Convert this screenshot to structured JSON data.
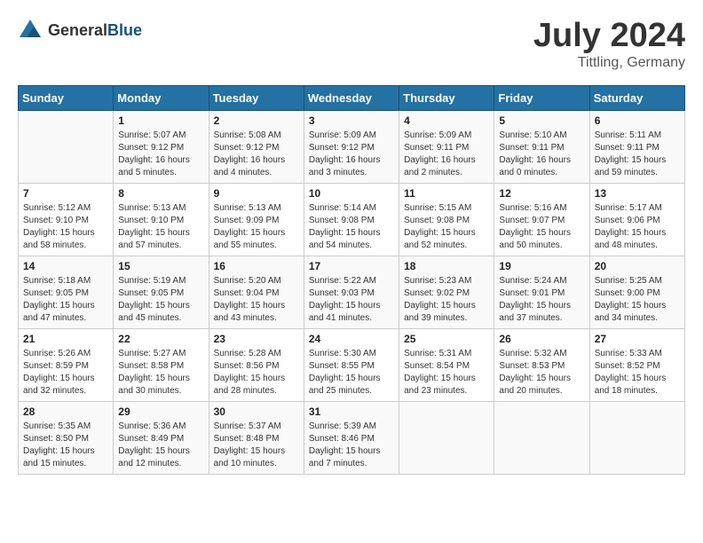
{
  "header": {
    "logo_general": "General",
    "logo_blue": "Blue",
    "month_year": "July 2024",
    "location": "Tittling, Germany"
  },
  "days_of_week": [
    "Sunday",
    "Monday",
    "Tuesday",
    "Wednesday",
    "Thursday",
    "Friday",
    "Saturday"
  ],
  "weeks": [
    [
      {
        "day": "",
        "info": ""
      },
      {
        "day": "1",
        "info": "Sunrise: 5:07 AM\nSunset: 9:12 PM\nDaylight: 16 hours\nand 5 minutes."
      },
      {
        "day": "2",
        "info": "Sunrise: 5:08 AM\nSunset: 9:12 PM\nDaylight: 16 hours\nand 4 minutes."
      },
      {
        "day": "3",
        "info": "Sunrise: 5:09 AM\nSunset: 9:12 PM\nDaylight: 16 hours\nand 3 minutes."
      },
      {
        "day": "4",
        "info": "Sunrise: 5:09 AM\nSunset: 9:11 PM\nDaylight: 16 hours\nand 2 minutes."
      },
      {
        "day": "5",
        "info": "Sunrise: 5:10 AM\nSunset: 9:11 PM\nDaylight: 16 hours\nand 0 minutes."
      },
      {
        "day": "6",
        "info": "Sunrise: 5:11 AM\nSunset: 9:11 PM\nDaylight: 15 hours\nand 59 minutes."
      }
    ],
    [
      {
        "day": "7",
        "info": "Sunrise: 5:12 AM\nSunset: 9:10 PM\nDaylight: 15 hours\nand 58 minutes."
      },
      {
        "day": "8",
        "info": "Sunrise: 5:13 AM\nSunset: 9:10 PM\nDaylight: 15 hours\nand 57 minutes."
      },
      {
        "day": "9",
        "info": "Sunrise: 5:13 AM\nSunset: 9:09 PM\nDaylight: 15 hours\nand 55 minutes."
      },
      {
        "day": "10",
        "info": "Sunrise: 5:14 AM\nSunset: 9:08 PM\nDaylight: 15 hours\nand 54 minutes."
      },
      {
        "day": "11",
        "info": "Sunrise: 5:15 AM\nSunset: 9:08 PM\nDaylight: 15 hours\nand 52 minutes."
      },
      {
        "day": "12",
        "info": "Sunrise: 5:16 AM\nSunset: 9:07 PM\nDaylight: 15 hours\nand 50 minutes."
      },
      {
        "day": "13",
        "info": "Sunrise: 5:17 AM\nSunset: 9:06 PM\nDaylight: 15 hours\nand 48 minutes."
      }
    ],
    [
      {
        "day": "14",
        "info": "Sunrise: 5:18 AM\nSunset: 9:05 PM\nDaylight: 15 hours\nand 47 minutes."
      },
      {
        "day": "15",
        "info": "Sunrise: 5:19 AM\nSunset: 9:05 PM\nDaylight: 15 hours\nand 45 minutes."
      },
      {
        "day": "16",
        "info": "Sunrise: 5:20 AM\nSunset: 9:04 PM\nDaylight: 15 hours\nand 43 minutes."
      },
      {
        "day": "17",
        "info": "Sunrise: 5:22 AM\nSunset: 9:03 PM\nDaylight: 15 hours\nand 41 minutes."
      },
      {
        "day": "18",
        "info": "Sunrise: 5:23 AM\nSunset: 9:02 PM\nDaylight: 15 hours\nand 39 minutes."
      },
      {
        "day": "19",
        "info": "Sunrise: 5:24 AM\nSunset: 9:01 PM\nDaylight: 15 hours\nand 37 minutes."
      },
      {
        "day": "20",
        "info": "Sunrise: 5:25 AM\nSunset: 9:00 PM\nDaylight: 15 hours\nand 34 minutes."
      }
    ],
    [
      {
        "day": "21",
        "info": "Sunrise: 5:26 AM\nSunset: 8:59 PM\nDaylight: 15 hours\nand 32 minutes."
      },
      {
        "day": "22",
        "info": "Sunrise: 5:27 AM\nSunset: 8:58 PM\nDaylight: 15 hours\nand 30 minutes."
      },
      {
        "day": "23",
        "info": "Sunrise: 5:28 AM\nSunset: 8:56 PM\nDaylight: 15 hours\nand 28 minutes."
      },
      {
        "day": "24",
        "info": "Sunrise: 5:30 AM\nSunset: 8:55 PM\nDaylight: 15 hours\nand 25 minutes."
      },
      {
        "day": "25",
        "info": "Sunrise: 5:31 AM\nSunset: 8:54 PM\nDaylight: 15 hours\nand 23 minutes."
      },
      {
        "day": "26",
        "info": "Sunrise: 5:32 AM\nSunset: 8:53 PM\nDaylight: 15 hours\nand 20 minutes."
      },
      {
        "day": "27",
        "info": "Sunrise: 5:33 AM\nSunset: 8:52 PM\nDaylight: 15 hours\nand 18 minutes."
      }
    ],
    [
      {
        "day": "28",
        "info": "Sunrise: 5:35 AM\nSunset: 8:50 PM\nDaylight: 15 hours\nand 15 minutes."
      },
      {
        "day": "29",
        "info": "Sunrise: 5:36 AM\nSunset: 8:49 PM\nDaylight: 15 hours\nand 12 minutes."
      },
      {
        "day": "30",
        "info": "Sunrise: 5:37 AM\nSunset: 8:48 PM\nDaylight: 15 hours\nand 10 minutes."
      },
      {
        "day": "31",
        "info": "Sunrise: 5:39 AM\nSunset: 8:46 PM\nDaylight: 15 hours\nand 7 minutes."
      },
      {
        "day": "",
        "info": ""
      },
      {
        "day": "",
        "info": ""
      },
      {
        "day": "",
        "info": ""
      }
    ]
  ]
}
